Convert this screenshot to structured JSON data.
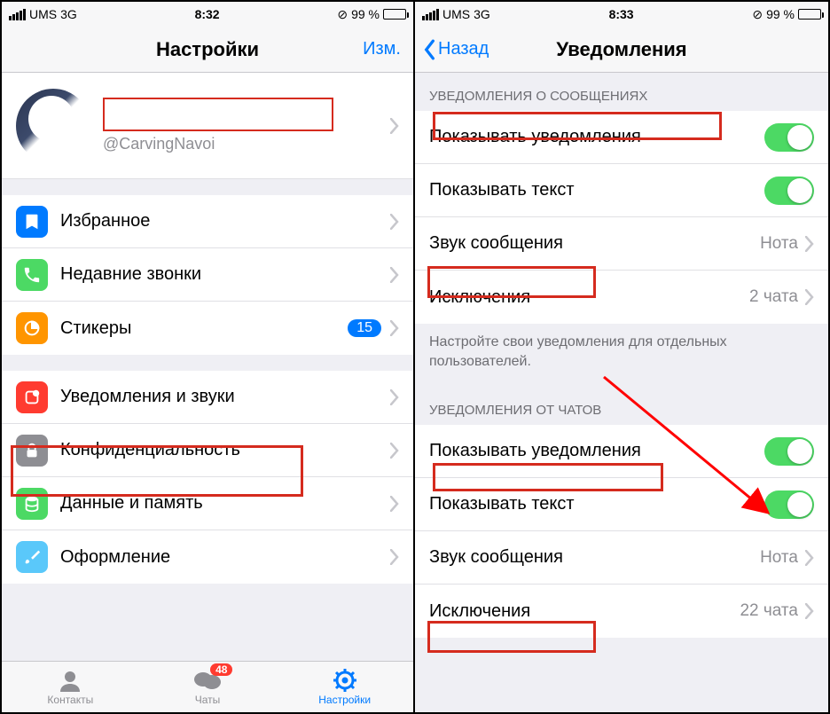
{
  "left": {
    "status": {
      "carrier": "UMS",
      "network": "3G",
      "time": "8:32",
      "battery": "99 %"
    },
    "nav": {
      "title": "Настройки",
      "edit": "Изм."
    },
    "profile": {
      "username": "@CarvingNavoi"
    },
    "group1": [
      {
        "label": "Избранное"
      },
      {
        "label": "Недавние звонки"
      },
      {
        "label": "Стикеры",
        "badge": "15"
      }
    ],
    "group2": [
      {
        "label": "Уведомления и звуки"
      },
      {
        "label": "Конфиденциальность"
      },
      {
        "label": "Данные и память"
      },
      {
        "label": "Оформление"
      }
    ],
    "tabs": {
      "contacts": "Контакты",
      "chats": "Чаты",
      "chats_badge": "48",
      "settings": "Настройки"
    }
  },
  "right": {
    "status": {
      "carrier": "UMS",
      "network": "3G",
      "time": "8:33",
      "battery": "99 %"
    },
    "nav": {
      "back": "Назад",
      "title": "Уведомления"
    },
    "section1": {
      "header": "УВЕДОМЛЕНИЯ О СООБЩЕНИЯХ",
      "rows": {
        "show_notify": "Показывать уведомления",
        "show_text": "Показывать текст",
        "sound_label": "Звук сообщения",
        "sound_value": "Нота",
        "exceptions_label": "Исключения",
        "exceptions_value": "2 чата"
      },
      "footer": "Настройте свои уведомления для отдельных пользователей."
    },
    "section2": {
      "header": "УВЕДОМЛЕНИЯ ОТ ЧАТОВ",
      "rows": {
        "show_notify": "Показывать уведомления",
        "show_text": "Показывать текст",
        "sound_label": "Звук сообщения",
        "sound_value": "Нота",
        "exceptions_label": "Исключения",
        "exceptions_value": "22 чата"
      }
    }
  }
}
